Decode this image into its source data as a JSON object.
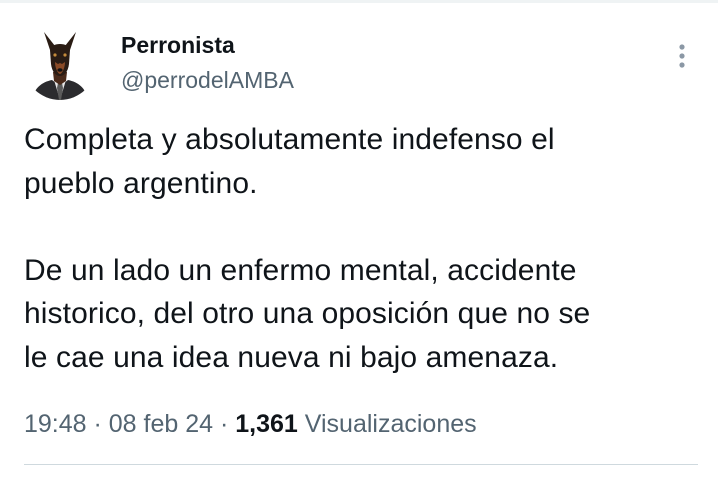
{
  "tweet": {
    "author": {
      "display_name": "Perronista",
      "handle": "@perrodelAMBA",
      "avatar": "doberman-in-suit-avatar"
    },
    "text": "Completa y absolutamente indefenso el\npueblo argentino.\n\nDe un lado un enfermo mental, accidente\nhistorico, del otro una oposición que no se\nle cae una idea nueva ni bajo amenaza.",
    "meta": {
      "time": "19:48",
      "separator": " · ",
      "date": "08 feb 24",
      "views_count": "1,361",
      "views_label": "Visualizaciones"
    }
  },
  "icons": {
    "more": "more-vertical-icon"
  },
  "colors": {
    "text_primary": "#0f1419",
    "text_secondary": "#536471",
    "divider": "#cfd9de",
    "background": "#ffffff"
  }
}
